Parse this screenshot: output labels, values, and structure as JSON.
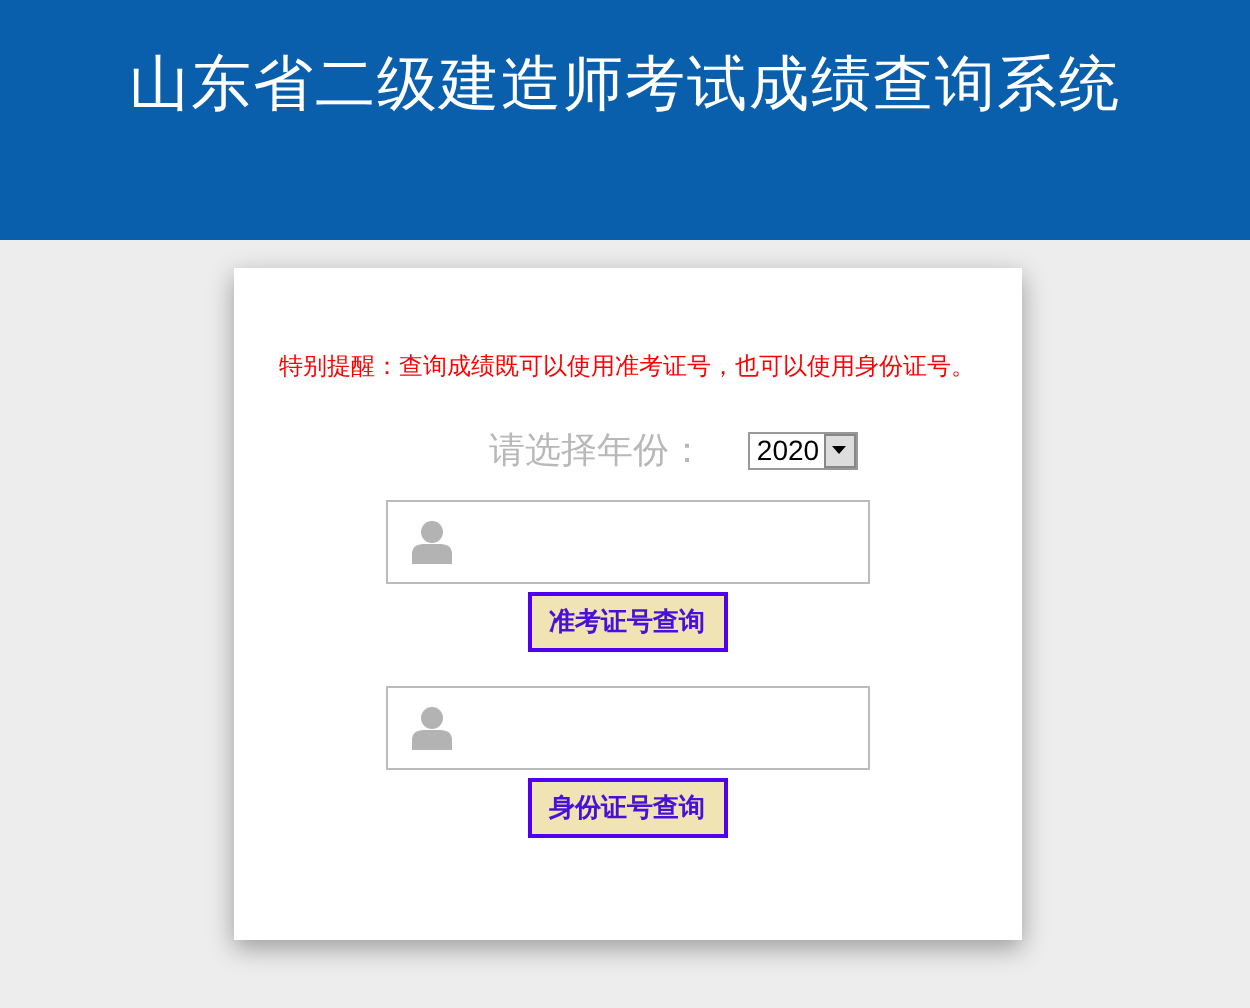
{
  "header": {
    "title": "山东省二级建造师考试成绩查询系统"
  },
  "notice": "特别提醒：查询成绩既可以使用准考证号，也可以使用身份证号。",
  "year": {
    "label": "请选择年份：",
    "value": "2020"
  },
  "queries": [
    {
      "button": "准考证号查询"
    },
    {
      "button": "身份证号查询"
    }
  ]
}
